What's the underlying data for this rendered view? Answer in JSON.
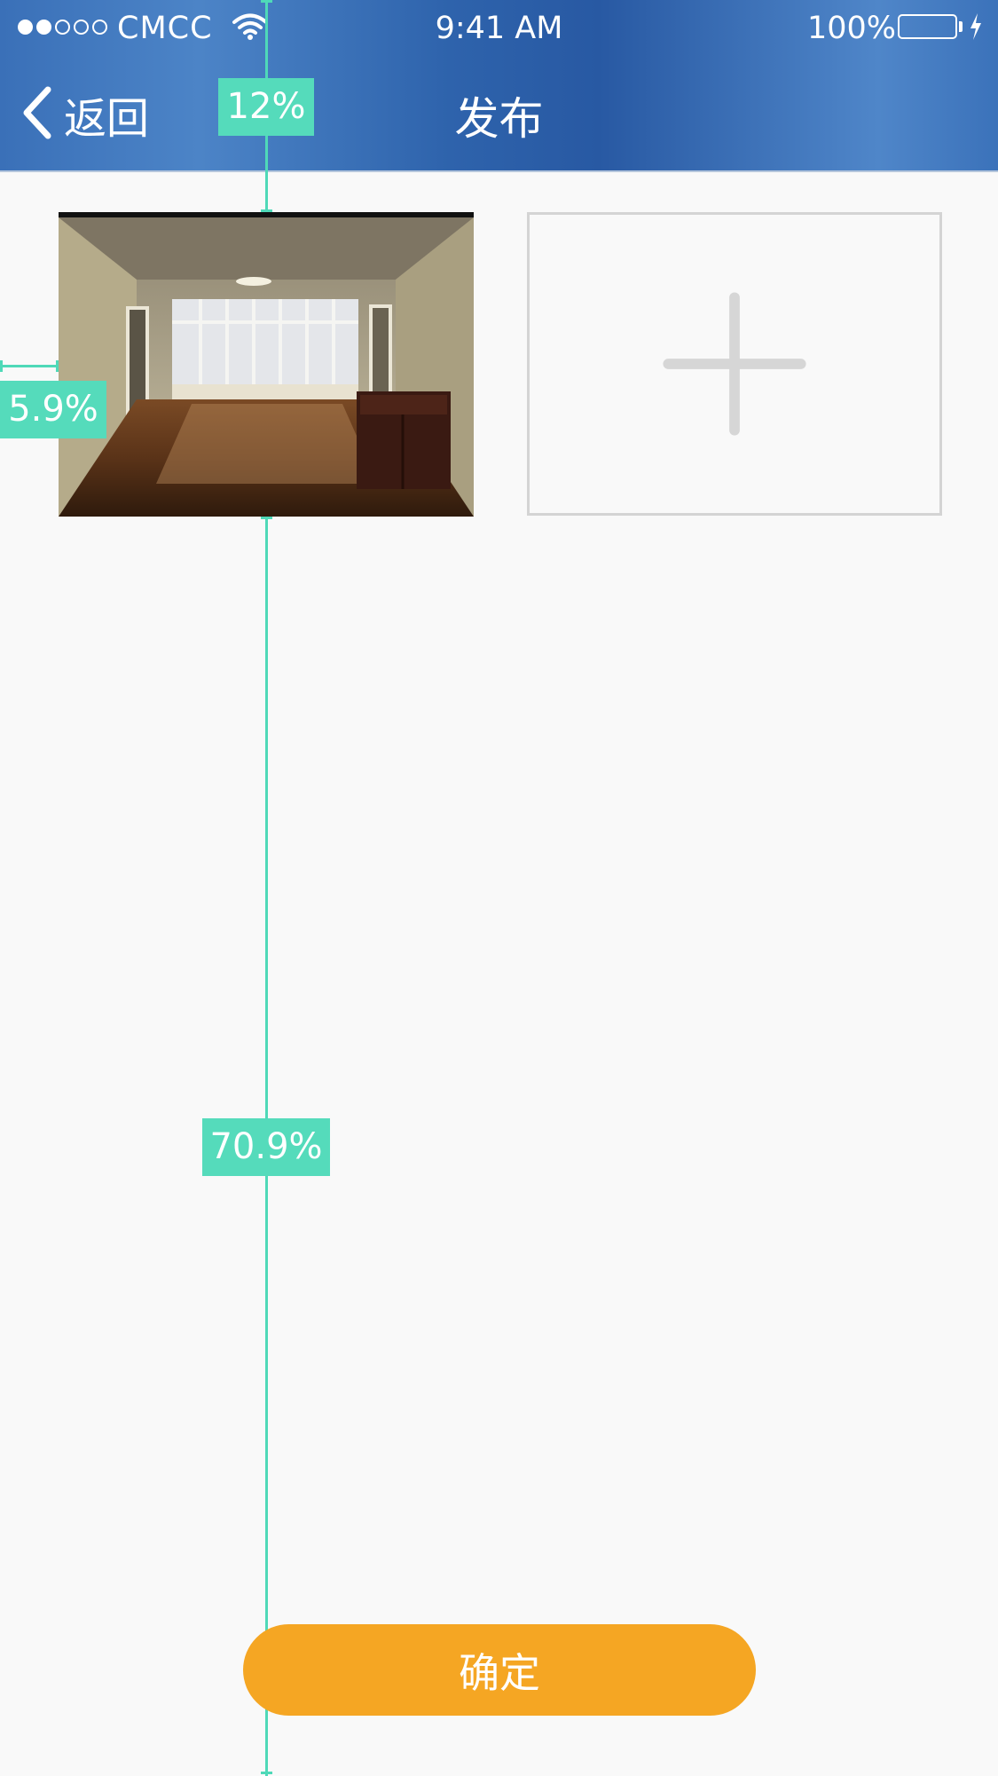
{
  "status_bar": {
    "carrier": "CMCC",
    "signal_bars_filled": 2,
    "signal_bars_total": 5,
    "time": "9:41 AM",
    "battery_percent": "100%",
    "battery_level": 1.0,
    "battery_color": "#4cd964"
  },
  "nav": {
    "back_label": "返回",
    "back_icon": "chevron-left-icon",
    "title": "发布"
  },
  "images": {
    "photo_description": "empty apartment room with wooden floor and bay window",
    "add_icon": "plus-icon"
  },
  "measurements": {
    "top_offset": "12%",
    "left_offset": "5.9%",
    "bottom_offset": "70.9%",
    "color": "#4fd9b8"
  },
  "actions": {
    "confirm_label": "确定",
    "confirm_color": "#f5a623"
  },
  "colors": {
    "header": "#2f63ac",
    "background": "#f9f9f9"
  }
}
